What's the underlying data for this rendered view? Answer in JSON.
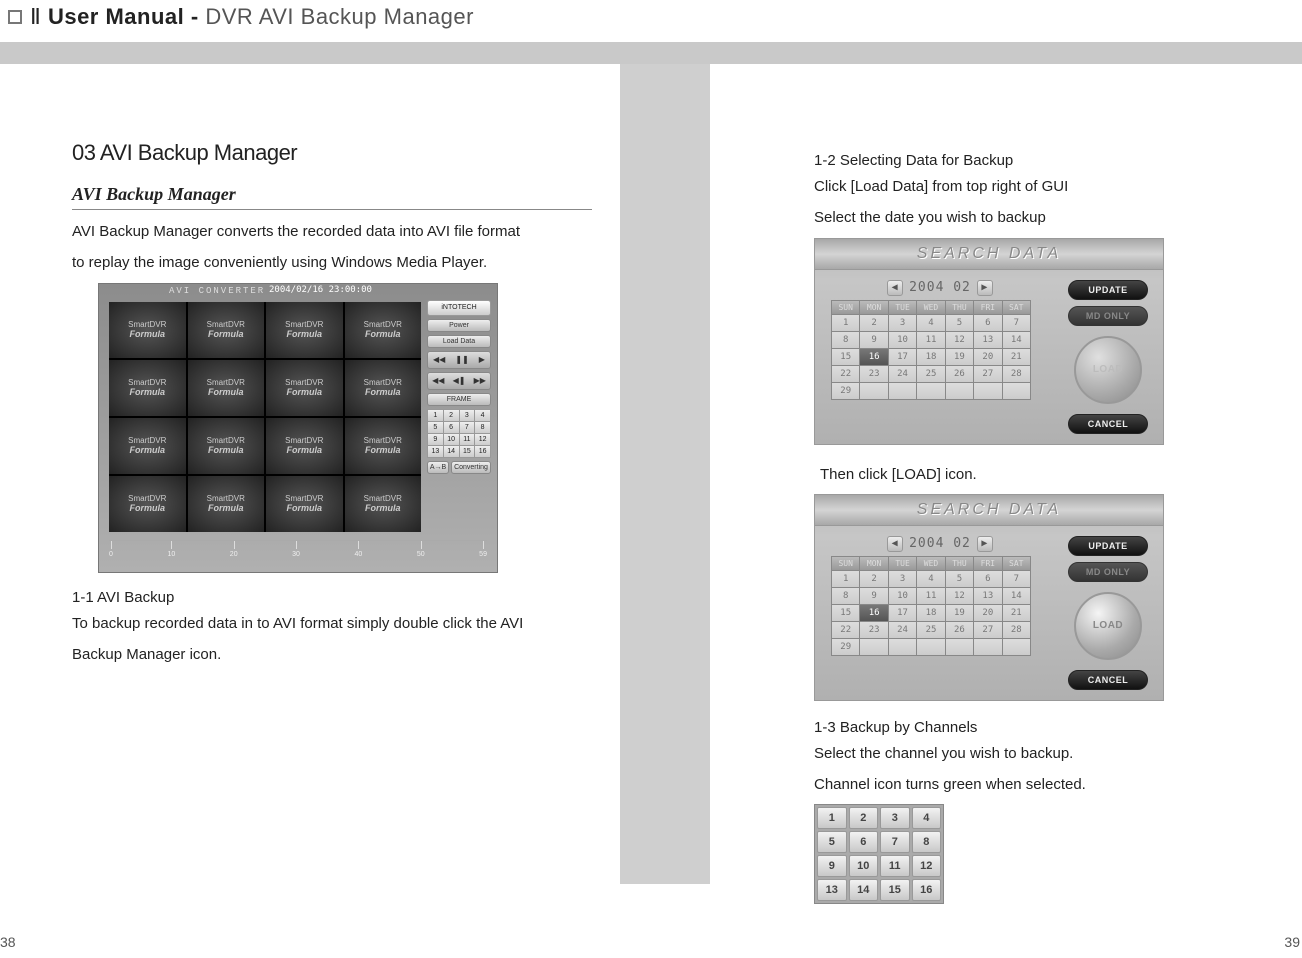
{
  "header": {
    "part": "Ⅱ",
    "title": "User Manual",
    "dash": "-",
    "subtitle": "DVR AVI Backup Manager"
  },
  "pages": {
    "left": "38",
    "right": "39"
  },
  "left": {
    "section_title": "03 AVI Backup Manager",
    "subtitle_italic": "AVI Backup Manager",
    "intro_l1": "AVI Backup Manager converts the recorded data into AVI file format",
    "intro_l2": "to replay the image conveniently using Windows Media Player.",
    "s11_head": "1-1 AVI Backup",
    "s11_l1": "To backup recorded data in to AVI format simply double click the AVI",
    "s11_l2": "Backup Manager icon."
  },
  "avi": {
    "title": "AVI CONVERTER",
    "timestamp": "2004/02/16 23:00:00",
    "cell_top": "SmartDVR",
    "cell_label": "Formula",
    "btn_power": "Power",
    "btn_loaddata": "Load Data",
    "btn_frame": "FRAME",
    "ab_label": "A→B",
    "convert_label": "Converting",
    "numbers": [
      "1",
      "2",
      "3",
      "4",
      "5",
      "6",
      "7",
      "8",
      "9",
      "10",
      "11",
      "12",
      "13",
      "14",
      "15",
      "16"
    ],
    "ruler": [
      "0",
      "10",
      "20",
      "30",
      "40",
      "50",
      "59"
    ]
  },
  "right": {
    "s12_head": "1-2 Selecting Data for Backup",
    "s12_l1": "Click [Load Data] from top right of GUI",
    "s12_l2": "Select the date you wish to backup",
    "then_load": "Then click [LOAD] icon.",
    "s13_head": "1-3 Backup by Channels",
    "s13_l1": "Select the channel you wish to backup.",
    "s13_l2": "Channel icon turns green when selected."
  },
  "search": {
    "title": "SEARCH DATA",
    "date": "2004  02",
    "dows": [
      "SUN",
      "MON",
      "TUE",
      "WED",
      "THU",
      "FRI",
      "SAT"
    ],
    "days": [
      "1",
      "2",
      "3",
      "4",
      "5",
      "6",
      "7",
      "8",
      "9",
      "10",
      "11",
      "12",
      "13",
      "14",
      "15",
      "16",
      "17",
      "18",
      "19",
      "20",
      "21",
      "22",
      "23",
      "24",
      "25",
      "26",
      "27",
      "28",
      "29"
    ],
    "selected_day": "16",
    "btn_update": "UPDATE",
    "btn_mdonly": "MD ONLY",
    "btn_load": "LOAD",
    "btn_cancel": "CANCEL"
  },
  "channels": [
    "1",
    "2",
    "3",
    "4",
    "5",
    "6",
    "7",
    "8",
    "9",
    "10",
    "11",
    "12",
    "13",
    "14",
    "15",
    "16"
  ]
}
